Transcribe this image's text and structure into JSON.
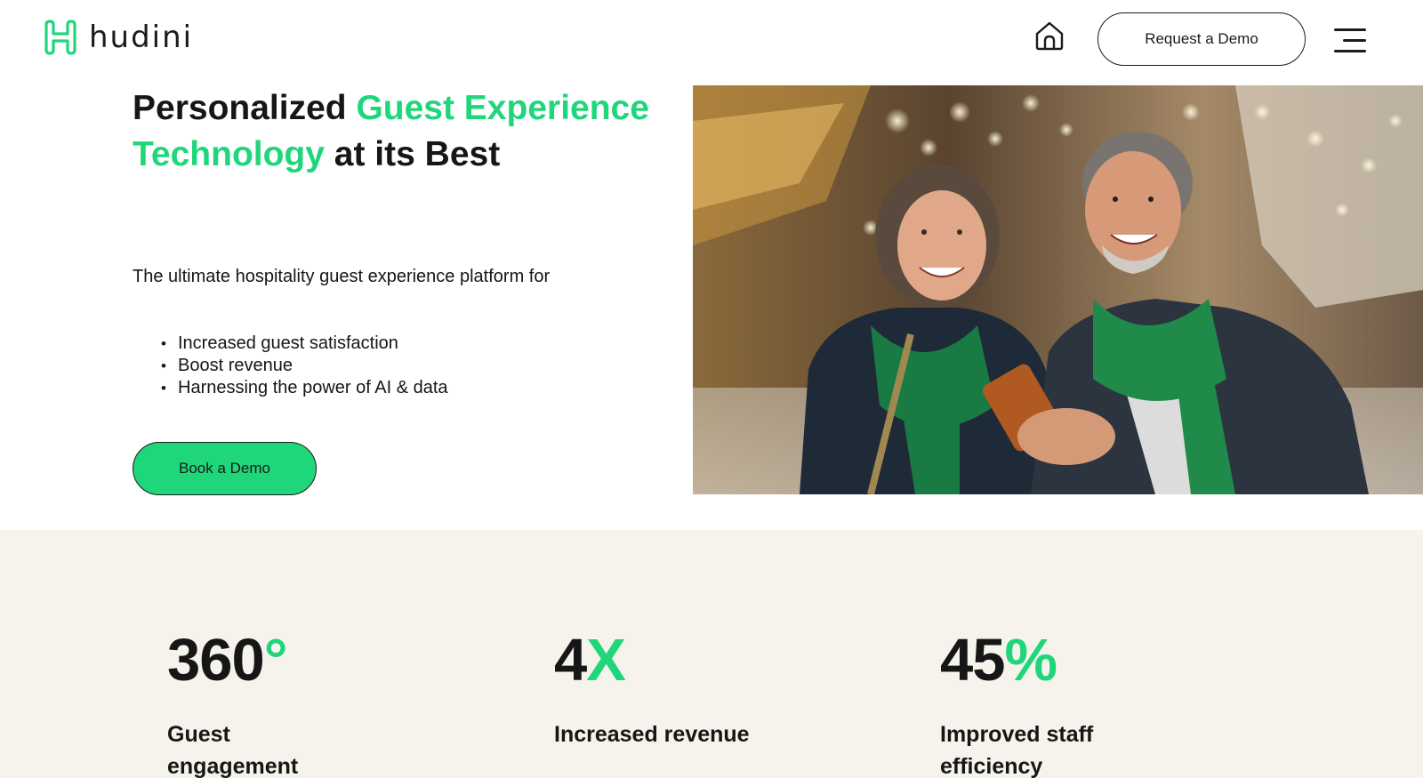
{
  "header": {
    "logo_text": "hudini",
    "request_demo_label": "Request a Demo"
  },
  "hero": {
    "title_part1": "Personalized ",
    "title_accent": "Guest Experience Technology",
    "title_part2": " at its Best",
    "subtitle": "The ultimate hospitality guest experience platform for",
    "bullets": [
      "Increased guest satisfaction",
      "Boost revenue",
      "Harnessing the power of AI & data"
    ],
    "cta_label": "Book a Demo"
  },
  "stats": [
    {
      "number": "360",
      "accent": "°",
      "label": "Guest engagement"
    },
    {
      "number": "4",
      "accent": "X",
      "label": "Increased revenue"
    },
    {
      "number": "45",
      "accent": "%",
      "label": "Improved staff efficiency"
    }
  ],
  "colors": {
    "accent": "#1fd67a",
    "text": "#161616",
    "stats_background": "#f6f3ec"
  },
  "icons": {
    "logo": "hudini-logo-icon",
    "home": "home-icon",
    "menu": "menu-icon"
  }
}
